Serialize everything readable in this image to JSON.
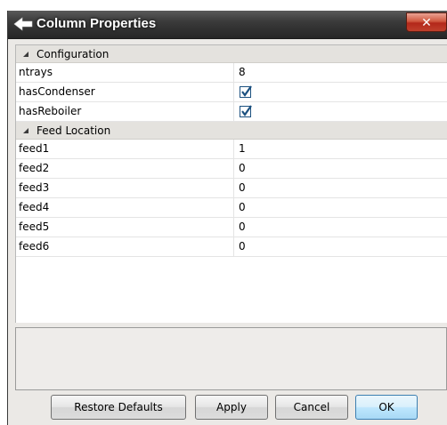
{
  "window": {
    "title": "Column Properties",
    "close_glyph": "✕"
  },
  "groups": [
    {
      "label": "Configuration",
      "rows": [
        {
          "name": "ntrays",
          "type": "text",
          "value": "8"
        },
        {
          "name": "hasCondenser",
          "type": "checkbox",
          "checked": true
        },
        {
          "name": "hasReboiler",
          "type": "checkbox",
          "checked": true
        }
      ]
    },
    {
      "label": "Feed Location",
      "rows": [
        {
          "name": "feed1",
          "type": "text",
          "value": "1"
        },
        {
          "name": "feed2",
          "type": "text",
          "value": "0"
        },
        {
          "name": "feed3",
          "type": "text",
          "value": "0"
        },
        {
          "name": "feed4",
          "type": "text",
          "value": "0"
        },
        {
          "name": "feed5",
          "type": "text",
          "value": "0"
        },
        {
          "name": "feed6",
          "type": "text",
          "value": "0"
        }
      ]
    }
  ],
  "buttons": {
    "restore_defaults": "Restore Defaults",
    "apply": "Apply",
    "cancel": "Cancel",
    "ok": "OK"
  },
  "colors": {
    "titlebar": "#3a3a3a",
    "close_button": "#c0402c",
    "checkmark": "#1c5180"
  }
}
